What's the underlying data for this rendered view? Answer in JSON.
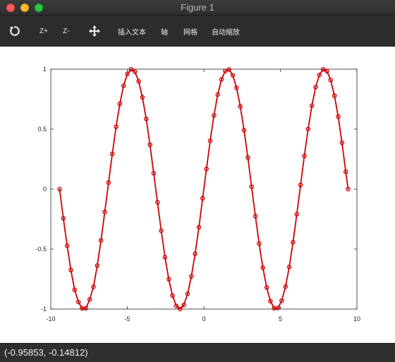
{
  "window": {
    "title": "Figure 1"
  },
  "toolbar": {
    "reset_icon": "rotate-reset-icon",
    "zoom_in_label": "Z+",
    "zoom_out_label": "Z-",
    "pan_icon": "move-arrows-icon",
    "insert_text_label": "插入文本",
    "axis_label": "轴",
    "grid_label": "网格",
    "autoscale_label": "自动缩放"
  },
  "status": {
    "coordinates": "(-0.95853, -0.14812)"
  },
  "colors": {
    "series": "#cc0000",
    "titlebar": "#333333",
    "toolbar": "#2d2d2d",
    "statusbar": "#2f2f2f"
  },
  "chart_data": {
    "type": "line",
    "title": "",
    "xlabel": "",
    "ylabel": "",
    "xlim": [
      -10,
      10
    ],
    "ylim": [
      -1,
      1
    ],
    "xticks": [
      -10,
      -5,
      0,
      5,
      10
    ],
    "xtick_labels": [
      "-10",
      "-5",
      "0",
      "5",
      "10"
    ],
    "yticks": [
      1,
      0.5,
      0,
      -0.5,
      -1
    ],
    "ytick_labels": [
      "1",
      "0.5",
      "0",
      "-0.5",
      "-1"
    ],
    "grid": false,
    "legend": "none",
    "series": [
      {
        "line_style": "dotted",
        "marker": "circle",
        "color": "#cc0000",
        "x": [
          -9.425,
          -9.179,
          -8.933,
          -8.687,
          -8.441,
          -8.195,
          -7.949,
          -7.703,
          -7.457,
          -7.211,
          -6.965,
          -6.719,
          -6.473,
          -6.227,
          -5.981,
          -5.735,
          -5.489,
          -5.243,
          -4.997,
          -4.751,
          -4.505,
          -4.259,
          -4.013,
          -3.767,
          -3.521,
          -3.275,
          -3.029,
          -2.783,
          -2.537,
          -2.291,
          -2.045,
          -1.799,
          -1.553,
          -1.307,
          -1.061,
          -0.815,
          -0.569,
          -0.323,
          -0.077,
          0.169,
          0.415,
          0.661,
          0.907,
          1.153,
          1.399,
          1.645,
          1.891,
          2.137,
          2.383,
          2.629,
          2.875,
          3.121,
          3.367,
          3.613,
          3.859,
          4.105,
          4.351,
          4.597,
          4.843,
          5.089,
          5.335,
          5.581,
          5.827,
          6.073,
          6.319,
          6.565,
          6.811,
          7.057,
          7.303,
          7.549,
          7.795,
          8.041,
          8.287,
          8.533,
          8.779,
          9.025,
          9.271,
          9.425
        ],
        "y": [
          0.0,
          -0.243,
          -0.472,
          -0.675,
          -0.84,
          -0.941,
          -0.995,
          -0.993,
          -0.92,
          -0.814,
          -0.637,
          -0.427,
          -0.191,
          0.054,
          0.294,
          0.52,
          0.711,
          0.862,
          0.96,
          0.999,
          0.979,
          0.899,
          0.765,
          0.586,
          0.37,
          0.133,
          -0.11,
          -0.347,
          -0.567,
          -0.752,
          -0.889,
          -0.974,
          -1.0,
          -0.966,
          -0.873,
          -0.727,
          -0.538,
          -0.317,
          -0.077,
          0.168,
          0.403,
          0.614,
          0.788,
          0.914,
          0.985,
          0.997,
          0.949,
          0.844,
          0.689,
          0.491,
          0.264,
          0.02,
          -0.225,
          -0.454,
          -0.656,
          -0.82,
          -0.935,
          -0.993,
          -0.991,
          -0.93,
          -0.813,
          -0.648,
          -0.443,
          -0.209,
          0.035,
          0.277,
          0.5,
          0.694,
          0.85,
          0.952,
          0.998,
          0.983,
          0.909,
          0.778,
          0.604,
          0.387,
          0.145,
          0.0
        ]
      }
    ]
  }
}
